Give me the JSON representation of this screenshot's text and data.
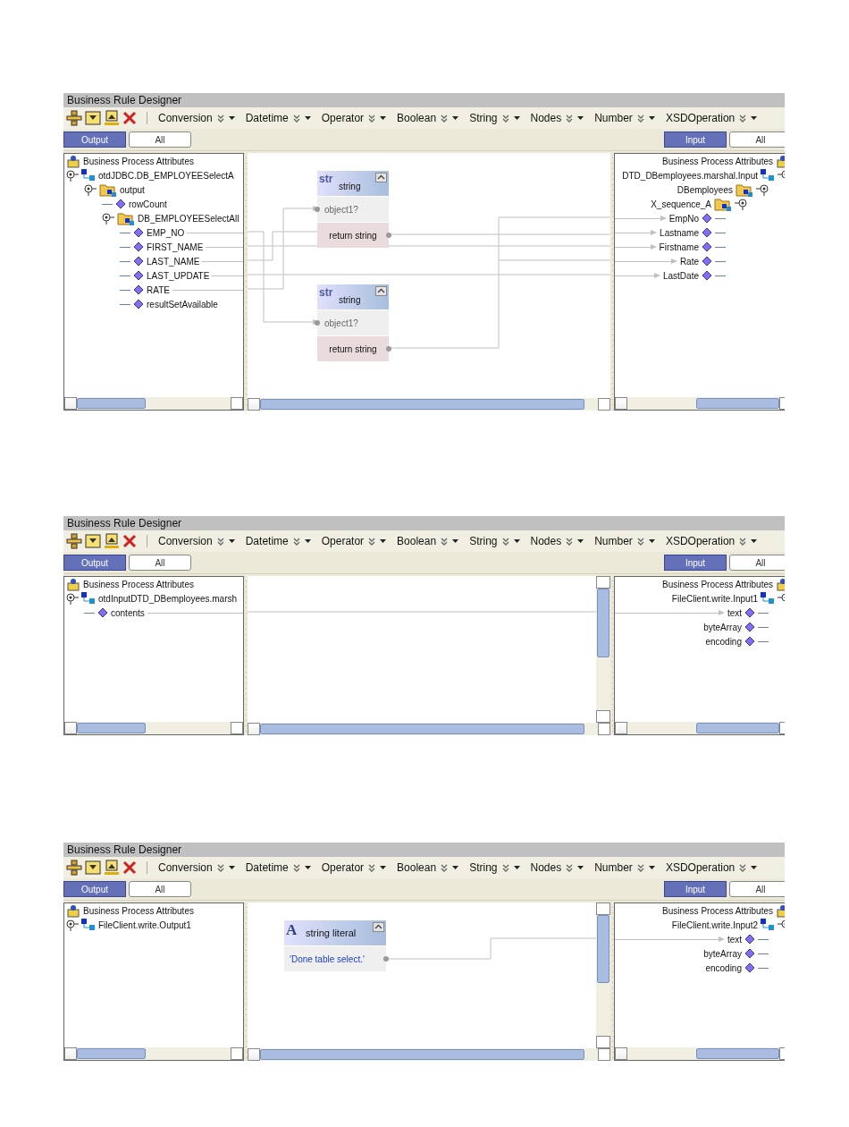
{
  "designers": [
    {
      "title": "Business Rule Designer",
      "toolbar_menus": [
        "Conversion",
        "Datetime",
        "Operator",
        "Boolean",
        "String",
        "Nodes",
        "Number",
        "XSDOperation"
      ],
      "output_tabs": [
        {
          "label": "Output",
          "selected": true
        },
        {
          "label": "All",
          "selected": false
        }
      ],
      "input_tabs": [
        {
          "label": "Input",
          "selected": true
        },
        {
          "label": "All",
          "selected": false
        }
      ],
      "source": {
        "header": "Business Process Attributes",
        "items": [
          {
            "label": "otdJDBC.DB_EMPLOYEESelectA",
            "kind": "node",
            "children": [
              {
                "label": "output",
                "kind": "folder",
                "children": [
                  {
                    "label": "rowCount",
                    "kind": "field",
                    "linked": false
                  },
                  {
                    "label": "DB_EMPLOYEESelectAll",
                    "kind": "folder",
                    "children": [
                      {
                        "label": "EMP_NO",
                        "kind": "field",
                        "linked": true
                      },
                      {
                        "label": "FIRST_NAME",
                        "kind": "field",
                        "linked": true
                      },
                      {
                        "label": "LAST_NAME",
                        "kind": "field",
                        "linked": true
                      },
                      {
                        "label": "LAST_UPDATE",
                        "kind": "field",
                        "linked": true
                      },
                      {
                        "label": "RATE",
                        "kind": "field",
                        "linked": true
                      },
                      {
                        "label": "resultSetAvailable",
                        "kind": "field",
                        "linked": false
                      }
                    ]
                  }
                ]
              }
            ]
          }
        ]
      },
      "canvas": {
        "blocks": [
          {
            "kind": "function",
            "badge": "str",
            "title": "string",
            "rows": [
              {
                "kind": "input",
                "label": "object1?"
              },
              {
                "kind": "output",
                "label": "return string"
              }
            ]
          },
          {
            "kind": "function",
            "badge": "str",
            "title": "string",
            "rows": [
              {
                "kind": "input",
                "label": "object1?"
              },
              {
                "kind": "output",
                "label": "return string"
              }
            ]
          }
        ]
      },
      "target": {
        "header": "Business Process Attributes",
        "items": [
          {
            "label": "DTD_DBemployees.marshal.Input",
            "kind": "node",
            "children": [
              {
                "label": "DBemployees",
                "kind": "folder",
                "children": [
                  {
                    "label": "X_sequence_A",
                    "kind": "folder",
                    "children": [
                      {
                        "label": "EmpNo",
                        "kind": "field",
                        "linked": true
                      },
                      {
                        "label": "Lastname",
                        "kind": "field",
                        "linked": true
                      },
                      {
                        "label": "Firstname",
                        "kind": "field",
                        "linked": true
                      },
                      {
                        "label": "Rate",
                        "kind": "field",
                        "linked": true
                      },
                      {
                        "label": "LastDate",
                        "kind": "field",
                        "linked": true
                      }
                    ]
                  }
                ]
              }
            ]
          }
        ]
      }
    },
    {
      "title": "Business Rule Designer",
      "toolbar_menus": [
        "Conversion",
        "Datetime",
        "Operator",
        "Boolean",
        "String",
        "Nodes",
        "Number",
        "XSDOperation"
      ],
      "output_tabs": [
        {
          "label": "Output",
          "selected": true
        },
        {
          "label": "All",
          "selected": false
        }
      ],
      "input_tabs": [
        {
          "label": "Input",
          "selected": true
        },
        {
          "label": "All",
          "selected": false
        }
      ],
      "source": {
        "header": "Business Process Attributes",
        "items": [
          {
            "label": "otdInputDTD_DBemployees.marsh",
            "kind": "node",
            "children": [
              {
                "label": "contents",
                "kind": "field",
                "linked": true
              }
            ]
          }
        ]
      },
      "canvas": {
        "vertical_scrollbar": true
      },
      "target": {
        "header": "Business Process Attributes",
        "items": [
          {
            "label": "FileClient.write.Input1",
            "kind": "node",
            "children": [
              {
                "label": "text",
                "kind": "field",
                "linked": true
              },
              {
                "label": "byteArray",
                "kind": "field",
                "linked": false
              },
              {
                "label": "encoding",
                "kind": "field",
                "linked": false
              }
            ]
          }
        ]
      }
    },
    {
      "title": "Business Rule Designer",
      "toolbar_menus": [
        "Conversion",
        "Datetime",
        "Operator",
        "Boolean",
        "String",
        "Nodes",
        "Number",
        "XSDOperation"
      ],
      "output_tabs": [
        {
          "label": "Output",
          "selected": true
        },
        {
          "label": "All",
          "selected": false
        }
      ],
      "input_tabs": [
        {
          "label": "Input",
          "selected": true
        },
        {
          "label": "All",
          "selected": false
        }
      ],
      "source": {
        "header": "Business Process Attributes",
        "items": [
          {
            "label": "FileClient.write.Output1",
            "kind": "node"
          }
        ]
      },
      "canvas": {
        "vertical_scrollbar": true,
        "blocks": [
          {
            "kind": "literal",
            "badge": "A",
            "title": "string literal",
            "rows": [
              {
                "kind": "value",
                "label": "'Done table select.'"
              }
            ]
          }
        ]
      },
      "target": {
        "header": "Business Process Attributes",
        "items": [
          {
            "label": "FileClient.write.Input2",
            "kind": "node",
            "children": [
              {
                "label": "text",
                "kind": "field",
                "linked": true
              },
              {
                "label": "byteArray",
                "kind": "field",
                "linked": false
              },
              {
                "label": "encoding",
                "kind": "field",
                "linked": false
              }
            ]
          }
        ]
      }
    }
  ]
}
